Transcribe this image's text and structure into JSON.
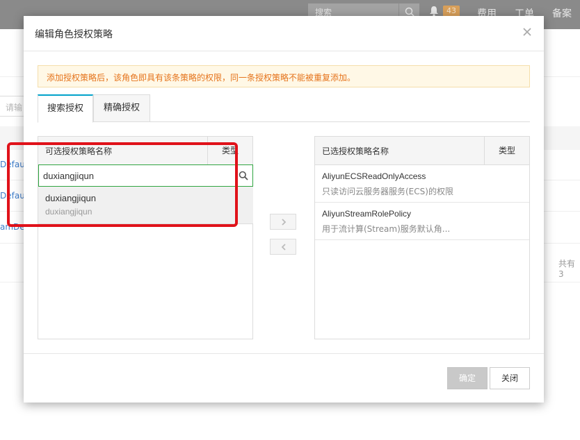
{
  "topbar": {
    "search_placeholder": "搜索",
    "notification_count": "43",
    "links": [
      "费用",
      "工单",
      "备案"
    ]
  },
  "background": {
    "input_placeholder": "请输",
    "links": [
      "DefaultRole",
      "Default",
      "amDefault"
    ],
    "row_links_visible": [
      "Defau",
      "Defaul",
      "amDefa"
    ],
    "total_text": "共有3"
  },
  "modal": {
    "title": "编辑角色授权策略",
    "alert": "添加授权策略后，该角色即具有该条策略的权限，同一条授权策略不能被重复添加。",
    "tabs": [
      {
        "label": "搜索授权",
        "active": true
      },
      {
        "label": "精确授权",
        "active": false
      }
    ],
    "available_panel": {
      "header_name": "可选授权策略名称",
      "header_type": "类型",
      "search_value": "duxiangjiqun",
      "results": [
        {
          "name": "duxiangjiqun",
          "description": "duxiangjiqun"
        }
      ]
    },
    "selected_panel": {
      "header_name": "已选授权策略名称",
      "header_type": "类型",
      "items": [
        {
          "name": "AliyunECSReadOnlyAccess",
          "description": "只读访问云服务器服务(ECS)的权限"
        },
        {
          "name": "AliyunStreamRolePolicy",
          "description": "用于流计算(Stream)服务默认角..."
        }
      ]
    },
    "buttons": {
      "ok": "确定",
      "close": "关闭"
    }
  },
  "colors": {
    "accent": "#00a2ca",
    "alert_text": "#e5731b",
    "search_border": "#2ea43f",
    "highlight": "#e0121a"
  }
}
